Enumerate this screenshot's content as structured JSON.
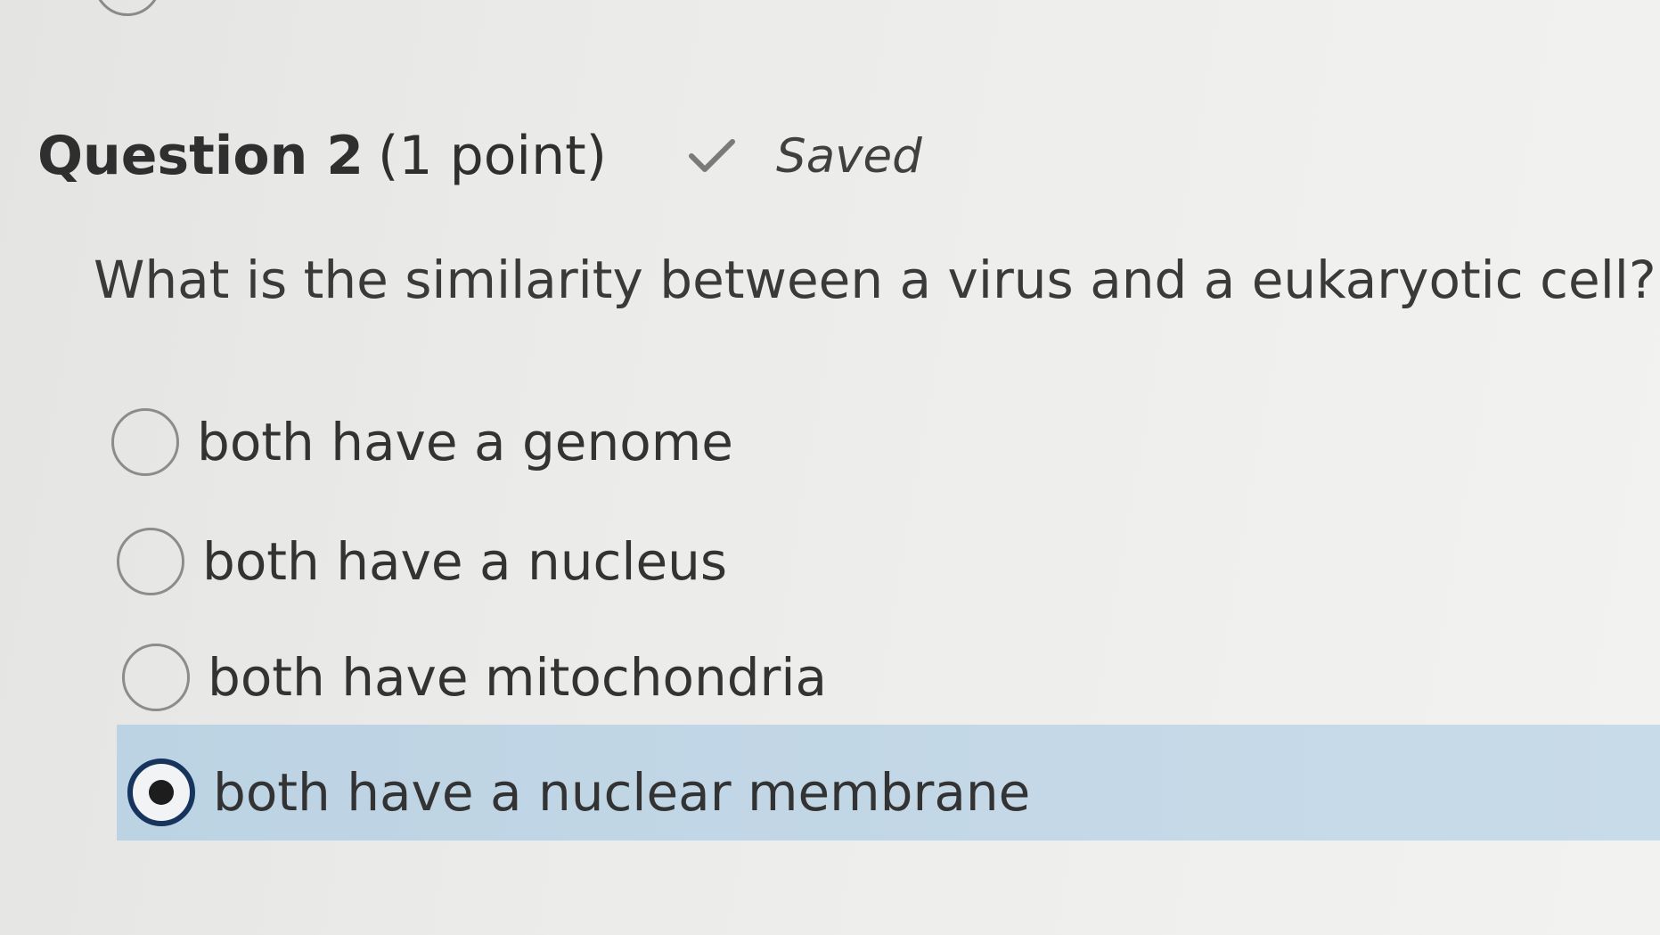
{
  "question": {
    "number_label": "Question 2",
    "points_label": "(1 point)",
    "status_icon": "checkmark-icon",
    "status_label": "Saved",
    "prompt": "What is the similarity between a virus and a eukaryotic cell?"
  },
  "options": [
    {
      "label": "both have a genome",
      "selected": false
    },
    {
      "label": "both have a nucleus",
      "selected": false
    },
    {
      "label": "both have mitochondria",
      "selected": false
    },
    {
      "label": "both have a nuclear membrane",
      "selected": true
    }
  ],
  "colors": {
    "selected_highlight": "#c4d8e7",
    "selected_radio_ring": "#17345c",
    "text": "#333333"
  }
}
